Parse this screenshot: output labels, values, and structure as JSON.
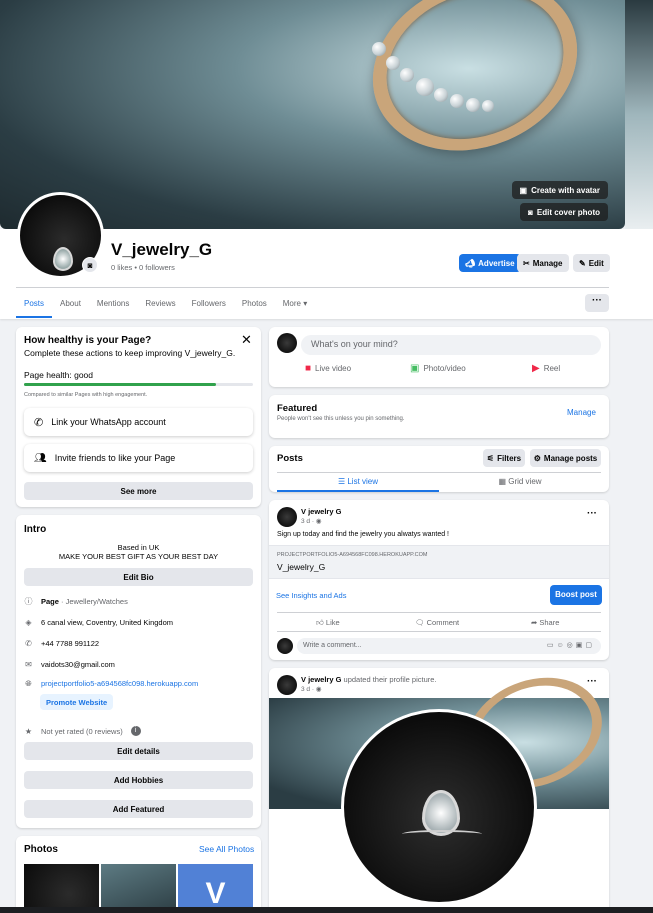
{
  "cover": {
    "create_avatar": "Create with avatar",
    "edit_cover": "Edit cover photo"
  },
  "profile": {
    "name": "V_jewelry_G",
    "stats": "0 likes • 0 followers"
  },
  "header_buttons": {
    "advertise": "Advertise",
    "manage": "Manage",
    "edit": "Edit"
  },
  "tabs": [
    "Posts",
    "About",
    "Mentions",
    "Reviews",
    "Followers",
    "Photos",
    "More ▾"
  ],
  "health": {
    "title": "How healthy is your Page?",
    "subtitle": "Complete these actions to keep improving V_jewelry_G.",
    "status": "Page health: good",
    "progress_pct": 84,
    "compare": "Compared to similar Pages with high engagement.",
    "actions": [
      "Link your WhatsApp account",
      "Invite friends to like your Page"
    ],
    "see_more": "See more"
  },
  "intro": {
    "title": "Intro",
    "bio_line1": "Based in UK",
    "bio_line2": "MAKE YOUR BEST GIFT AS YOUR BEST DAY",
    "edit_bio": "Edit Bio",
    "page_label": "Page",
    "category": " · Jewellery/Watches",
    "address": "6 canal view, Coventry, United Kingdom",
    "phone": "+44 7788 991122",
    "email": "vaidots30@gmail.com",
    "website": "projectportfolio5-a694568fc098.herokuapp.com",
    "promote": "Promote Website",
    "rating": "Not yet rated (0 reviews)",
    "edit_details": "Edit details",
    "add_hobbies": "Add Hobbies",
    "add_featured": "Add Featured"
  },
  "photos": {
    "title": "Photos",
    "see_all": "See All Photos"
  },
  "composer": {
    "placeholder": "What's on your mind?",
    "live": "Live video",
    "photo": "Photo/video",
    "reel": "Reel"
  },
  "featured": {
    "title": "Featured",
    "subtitle": "People won't see this unless you pin something.",
    "manage": "Manage"
  },
  "posts_bar": {
    "title": "Posts",
    "filters": "Filters",
    "manage_posts": "Manage posts",
    "list_view": "List view",
    "grid_view": "Grid view"
  },
  "post1": {
    "author": "V jewelry G",
    "time": "3 d",
    "text": "Sign up today and find the jewelry you alwatys wanted !",
    "link_domain": "PROJECTPORTFOLIO5-A694568FC098.HEROKUAPP.COM",
    "link_title": "V_jewelry_G",
    "insights": "See Insights and Ads",
    "boost": "Boost post",
    "like": "Like",
    "comment": "Comment",
    "share": "Share",
    "comment_placeholder": "Write a comment..."
  },
  "post2": {
    "author": "V jewelry G",
    "action": " updated their profile picture.",
    "time": "3 d"
  }
}
